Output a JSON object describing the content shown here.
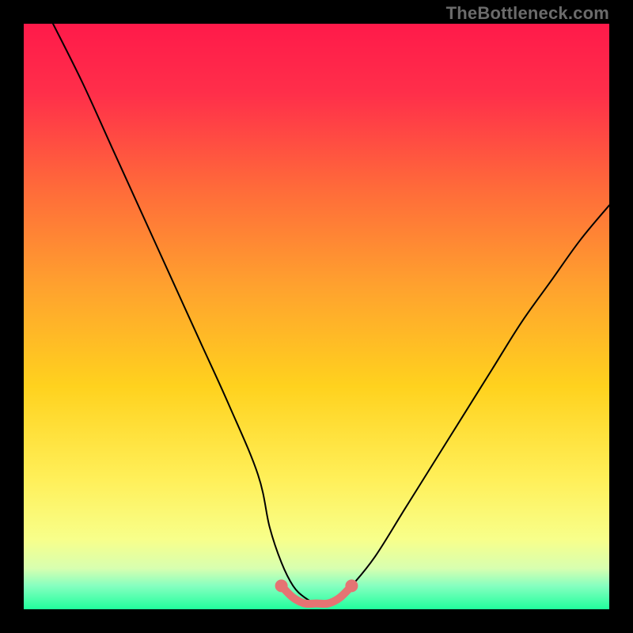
{
  "watermark": "TheBottleneck.com",
  "chart_data": {
    "type": "line",
    "title": "",
    "xlabel": "",
    "ylabel": "",
    "xlim": [
      0,
      100
    ],
    "ylim": [
      0,
      100
    ],
    "series": [
      {
        "name": "bottleneck-curve",
        "x": [
          5,
          10,
          15,
          20,
          25,
          30,
          35,
          40,
          42,
          44,
          46,
          48,
          50,
          52,
          54,
          56,
          60,
          65,
          70,
          75,
          80,
          85,
          90,
          95,
          100
        ],
        "y": [
          100,
          90,
          79,
          68,
          57,
          46,
          35,
          23,
          14,
          8,
          4,
          2,
          1,
          1,
          2,
          4,
          9,
          17,
          25,
          33,
          41,
          49,
          56,
          63,
          69
        ]
      },
      {
        "name": "optimal-marker",
        "x": [
          44,
          46,
          48,
          50,
          52,
          54,
          56
        ],
        "y": [
          4,
          2,
          1,
          1,
          1,
          2,
          4
        ]
      }
    ],
    "gradient_stops": [
      {
        "pos": 0.0,
        "color": "#ff1a4a"
      },
      {
        "pos": 0.12,
        "color": "#ff2f4a"
      },
      {
        "pos": 0.28,
        "color": "#ff6a3a"
      },
      {
        "pos": 0.45,
        "color": "#ffa22e"
      },
      {
        "pos": 0.62,
        "color": "#ffd21e"
      },
      {
        "pos": 0.78,
        "color": "#fff05a"
      },
      {
        "pos": 0.88,
        "color": "#f8ff8a"
      },
      {
        "pos": 0.93,
        "color": "#d8ffb0"
      },
      {
        "pos": 0.96,
        "color": "#86ffc0"
      },
      {
        "pos": 1.0,
        "color": "#20ff9c"
      }
    ],
    "marker_color": "#e57373",
    "curve_color": "#000000"
  }
}
